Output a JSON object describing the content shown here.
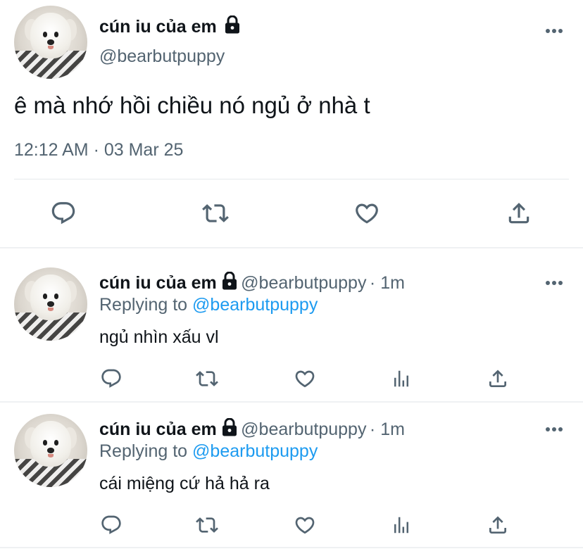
{
  "main_tweet": {
    "display_name": "cún iu của em",
    "handle": "@bearbutpuppy",
    "text": "ê mà nhớ hồi chiều nó ngủ ở nhà t",
    "timestamp": "12:12 AM · 03 Mar 25",
    "actions": [
      "reply-icon",
      "retweet-icon",
      "like-icon",
      "share-icon"
    ]
  },
  "replies": [
    {
      "display_name": "cún iu của em",
      "handle": "@bearbutpuppy",
      "time": "· 1m",
      "replying_prefix": "Replying to ",
      "replying_to": "@bearbutpuppy",
      "text": "ngủ nhìn xấu vl",
      "actions": [
        "reply-icon",
        "retweet-icon",
        "like-icon",
        "analytics-icon",
        "share-icon"
      ]
    },
    {
      "display_name": "cún iu của em",
      "handle": "@bearbutpuppy",
      "time": "· 1m",
      "replying_prefix": "Replying to ",
      "replying_to": "@bearbutpuppy",
      "text": "cái miệng cứ hả hả ra",
      "actions": [
        "reply-icon",
        "retweet-icon",
        "like-icon",
        "analytics-icon",
        "share-icon"
      ]
    }
  ],
  "colors": {
    "text": "#0f1419",
    "secondary": "#536471",
    "link": "#1d9bf0",
    "divider": "#e6e9ec"
  }
}
